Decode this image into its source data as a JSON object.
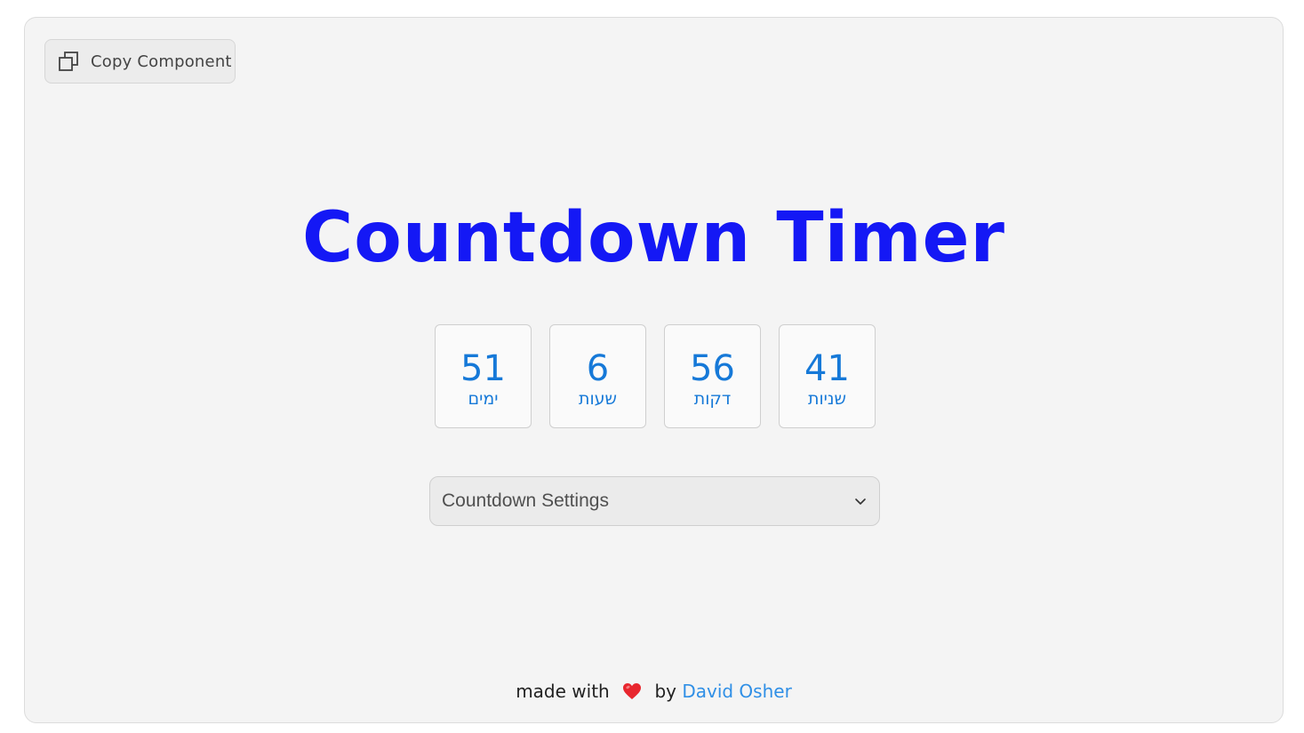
{
  "copy_button": {
    "label": "Copy Component",
    "icon": "copy-icon"
  },
  "title": "Countdown Timer",
  "accent_color": "#1418f5",
  "timer_color": "#1679d8",
  "timer": [
    {
      "value": "51",
      "label": "ימים"
    },
    {
      "value": "6",
      "label": "שעות"
    },
    {
      "value": "56",
      "label": "דקות"
    },
    {
      "value": "41",
      "label": "שניות"
    }
  ],
  "settings": {
    "label": "Countdown Settings",
    "icon": "chevron-down-icon"
  },
  "footer": {
    "prefix": "made with",
    "heart_icon": "heart-icon",
    "by": "by",
    "author": "David Osher",
    "link_color": "#2f8fe6"
  }
}
